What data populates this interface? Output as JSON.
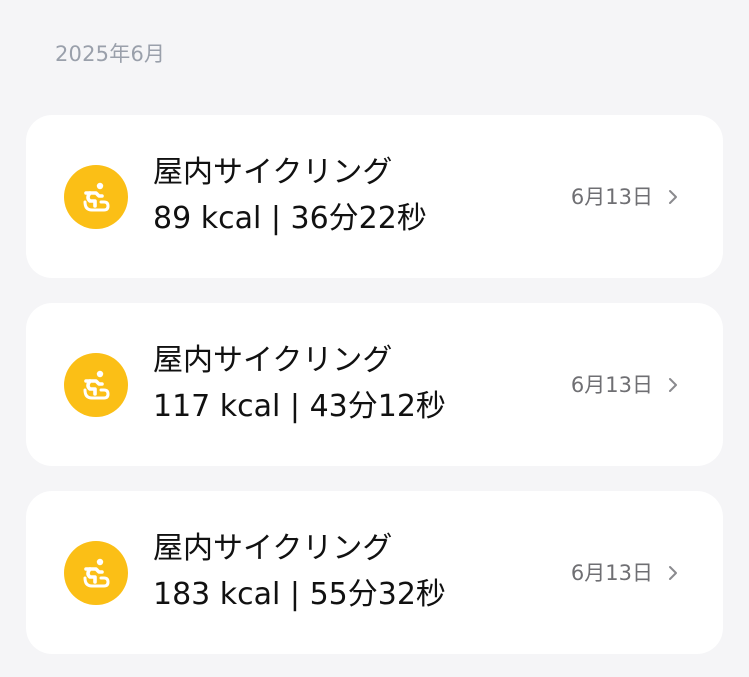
{
  "month_header": "2025年6月",
  "records": [
    {
      "title": "屋内サイクリング",
      "stats": "89 kcal | 36分22秒",
      "date": "6月13日",
      "icon": "cycling-icon"
    },
    {
      "title": "屋内サイクリング",
      "stats": "117 kcal | 43分12秒",
      "date": "6月13日",
      "icon": "cycling-icon"
    },
    {
      "title": "屋内サイクリング",
      "stats": "183 kcal | 55分32秒",
      "date": "6月13日",
      "icon": "cycling-icon"
    }
  ],
  "colors": {
    "background": "#f5f5f7",
    "card": "#ffffff",
    "icon_bg": "#fbbf16",
    "month_text": "#9aa0ab",
    "date_text": "#6f6f73"
  }
}
